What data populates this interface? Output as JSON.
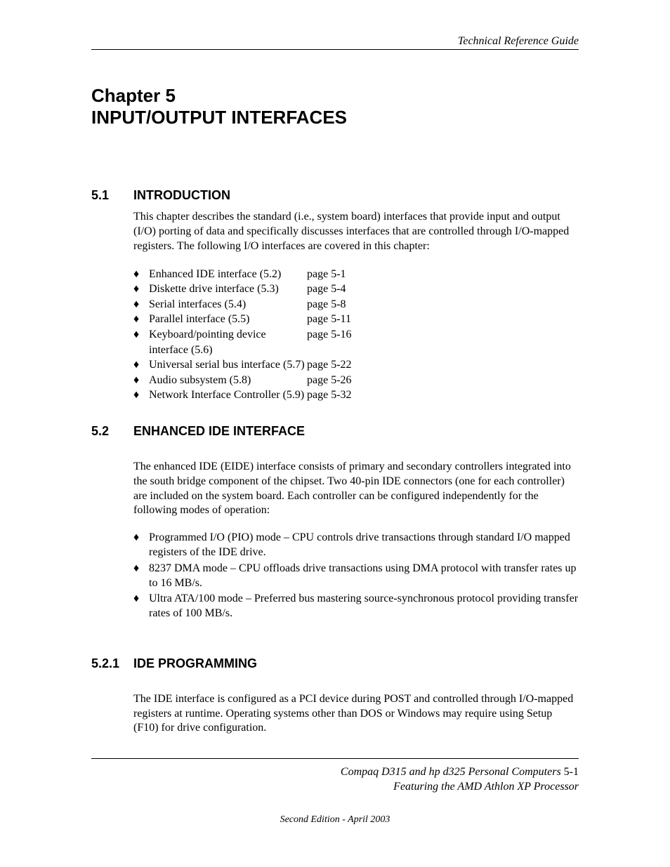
{
  "header": "Technical Reference Guide",
  "chapter_label": "Chapter 5",
  "chapter_title": "INPUT/OUTPUT INTERFACES",
  "sections": {
    "s51": {
      "num": "5.1",
      "title": "INTRODUCTION"
    },
    "s52": {
      "num": "5.2",
      "title": "ENHANCED IDE INTERFACE"
    },
    "s521": {
      "num": "5.2.1",
      "title": "IDE PROGRAMMING"
    }
  },
  "intro_para": "This chapter describes the standard (i.e., system board) interfaces that provide input and output (I/O) porting of data and specifically discusses interfaces that are controlled through I/O-mapped registers. The following I/O interfaces are covered in this chapter:",
  "toc": [
    {
      "label": "Enhanced IDE interface (5.2)",
      "page": "page 5-1"
    },
    {
      "label": "Diskette drive interface (5.3)",
      "page": "page 5-4"
    },
    {
      "label": "Serial interfaces (5.4)",
      "page": "page 5-8"
    },
    {
      "label": "Parallel interface (5.5)",
      "page": "page 5-11"
    },
    {
      "label": "Keyboard/pointing device interface (5.6)",
      "page": "page 5-16"
    },
    {
      "label": "Universal serial bus interface (5.7)",
      "page": "page 5-22"
    },
    {
      "label": "Audio subsystem (5.8)",
      "page": "page 5-26"
    },
    {
      "label": "Network Interface Controller (5.9)",
      "page": "page 5-32"
    }
  ],
  "eide_para": "The enhanced IDE (EIDE) interface consists of primary and secondary controllers integrated into the south bridge component of the chipset. Two 40-pin IDE connectors (one for each controller) are included on the system board. Each controller can be configured independently for the following modes of operation:",
  "modes": [
    "Programmed I/O (PIO) mode – CPU controls drive transactions through standard I/O mapped registers of the IDE drive.",
    "8237 DMA mode – CPU offloads drive transactions using DMA protocol with transfer rates up to 16 MB/s.",
    "Ultra ATA/100 mode – Preferred bus mastering source-synchronous protocol providing transfer rates of 100 MB/s."
  ],
  "ide_prog_para": "The IDE interface is configured as a PCI device during POST and controlled through I/O-mapped registers at runtime. Operating systems other than DOS or Windows may require using Setup (F10) for drive configuration.",
  "footer_line1a": "Compaq D315 and hp d325 Personal Computers",
  "footer_line1b": "  5-1",
  "footer_line2": "Featuring the AMD Athlon XP Processor",
  "edition": "Second Edition - April 2003",
  "bullet_char": "♦"
}
